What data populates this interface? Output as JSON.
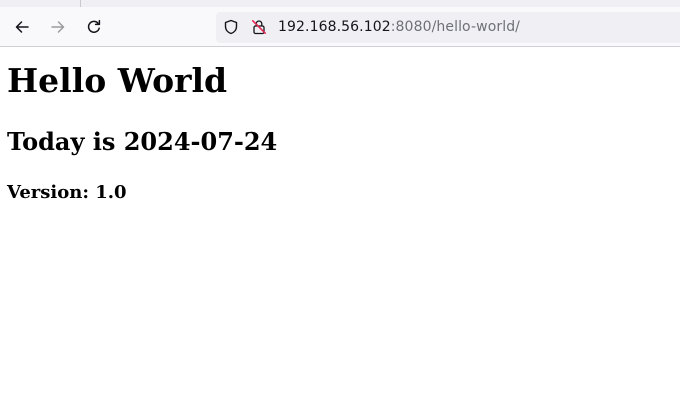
{
  "browser": {
    "address_bar": {
      "host": "192.168.56.102",
      "port_and_path": ":8080/hello-world/"
    },
    "icons": {
      "back": "arrow-left-icon",
      "forward": "arrow-right-icon",
      "reload": "reload-icon",
      "tracking_protection": "shield-icon",
      "connection": "insecure-lock-icon"
    }
  },
  "page": {
    "heading": "Hello World",
    "date_line": "Today is 2024-07-24",
    "version_line": "Version: 1.0"
  },
  "colors": {
    "chrome_background": "#f9f9fb",
    "url_bar_background": "#f0f0f4",
    "insecure_accent": "#e22850",
    "icon_color": "#15141a",
    "disabled_icon_color": "#9b9ba0"
  }
}
